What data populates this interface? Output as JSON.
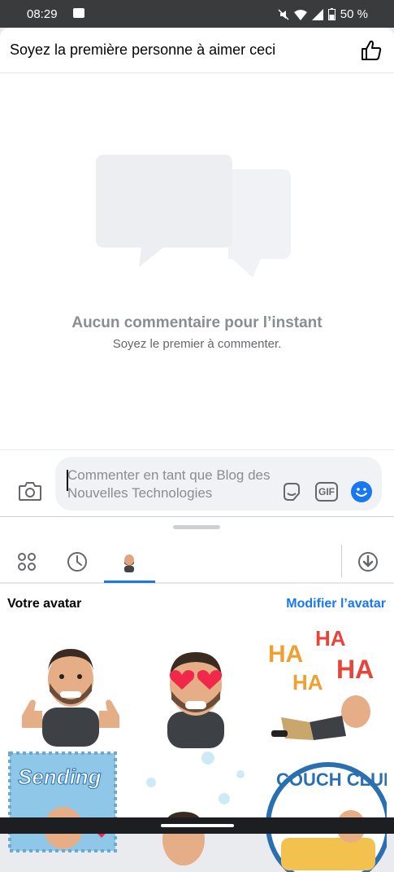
{
  "status": {
    "time": "08:29",
    "battery": "50 %"
  },
  "likes": {
    "text": "Soyez la première personne à aimer ceci"
  },
  "empty": {
    "title": "Aucun commentaire pour l’instant",
    "subtitle": "Soyez le premier à commenter."
  },
  "composer": {
    "placeholder": "Commenter en tant que Blog des Nouvelles Technologies",
    "gif": "GIF"
  },
  "tray": {
    "section_title": "Votre avatar",
    "edit_link": "Modifier l’avatar"
  },
  "stickers": [
    {
      "name": "thumbs-up",
      "text": ""
    },
    {
      "name": "heart-eyes",
      "text": ""
    },
    {
      "name": "laughing",
      "text": "HA HA HA HA"
    },
    {
      "name": "sending",
      "text": "Sending"
    },
    {
      "name": "bubbles",
      "text": ""
    },
    {
      "name": "couch-club",
      "text": "COUCH CLUB"
    }
  ],
  "colors": {
    "accent": "#1877f2",
    "muted": "#8a8d91",
    "dark": "#050505"
  }
}
